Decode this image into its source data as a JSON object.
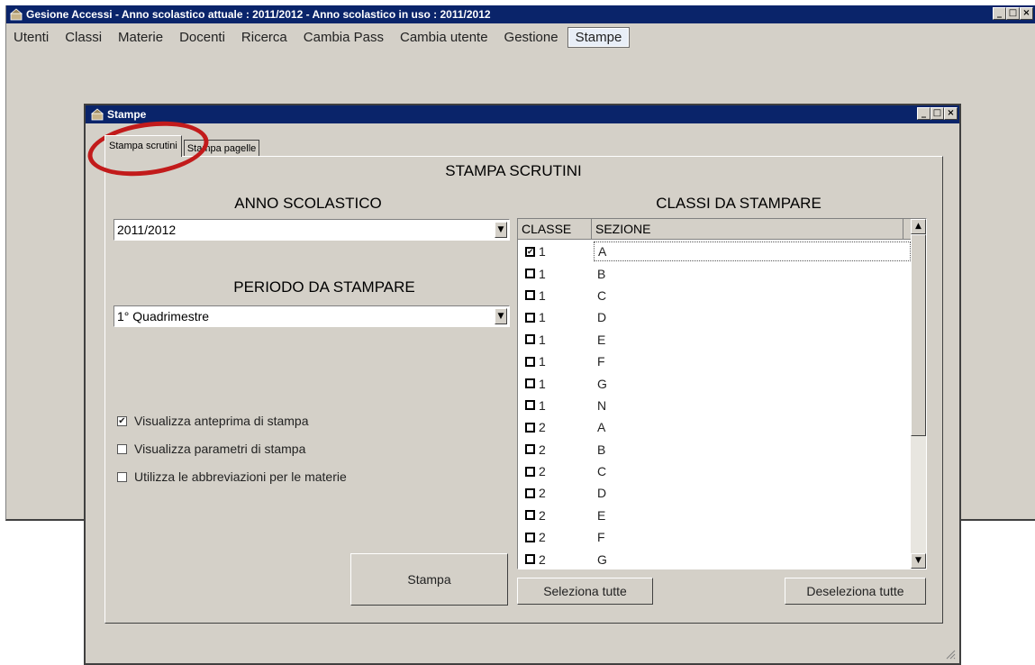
{
  "main_window": {
    "title": "Gesione Accessi - Anno scolastico attuale : 2011/2012 - Anno scolastico in uso : 2011/2012",
    "controls": {
      "minimize": "_",
      "maximize": "□",
      "close": "×"
    }
  },
  "menubar": {
    "items": [
      {
        "label": "Utenti"
      },
      {
        "label": "Classi"
      },
      {
        "label": "Materie"
      },
      {
        "label": "Docenti"
      },
      {
        "label": "Ricerca"
      },
      {
        "label": "Cambia Pass"
      },
      {
        "label": "Cambia utente"
      },
      {
        "label": "Gestione"
      },
      {
        "label": "Stampe",
        "active": true
      }
    ]
  },
  "child_window": {
    "title": "Stampe",
    "controls": {
      "minimize": "_",
      "maximize": "□",
      "close": "×"
    }
  },
  "tabs": [
    {
      "label": "Stampa scrutini",
      "active": true
    },
    {
      "label": "Stampa pagelle"
    }
  ],
  "panel": {
    "title": "STAMPA SCRUTINI",
    "anno_heading": "ANNO SCOLASTICO",
    "anno_value": "2011/2012",
    "periodo_heading": "PERIODO DA STAMPARE",
    "periodo_value": "1° Quadrimestre",
    "classi_heading": "CLASSI DA STAMPARE",
    "options": [
      {
        "label": "Visualizza anteprima di stampa",
        "checked": true
      },
      {
        "label": "Visualizza parametri di stampa",
        "checked": false
      },
      {
        "label": "Utilizza le abbreviazioni per le materie",
        "checked": false
      }
    ],
    "print_button": "Stampa",
    "select_all": "Seleziona tutte",
    "deselect_all": "Deseleziona tutte"
  },
  "grid": {
    "columns": [
      "CLASSE",
      "SEZIONE"
    ],
    "rows": [
      {
        "classe": "1",
        "sezione": "A",
        "checked": true
      },
      {
        "classe": "1",
        "sezione": "B",
        "checked": false
      },
      {
        "classe": "1",
        "sezione": "C",
        "checked": false
      },
      {
        "classe": "1",
        "sezione": "D",
        "checked": false
      },
      {
        "classe": "1",
        "sezione": "E",
        "checked": false
      },
      {
        "classe": "1",
        "sezione": "F",
        "checked": false
      },
      {
        "classe": "1",
        "sezione": "G",
        "checked": false
      },
      {
        "classe": "1",
        "sezione": "N",
        "checked": false
      },
      {
        "classe": "2",
        "sezione": "A",
        "checked": false
      },
      {
        "classe": "2",
        "sezione": "B",
        "checked": false
      },
      {
        "classe": "2",
        "sezione": "C",
        "checked": false
      },
      {
        "classe": "2",
        "sezione": "D",
        "checked": false
      },
      {
        "classe": "2",
        "sezione": "E",
        "checked": false
      },
      {
        "classe": "2",
        "sezione": "F",
        "checked": false
      },
      {
        "classe": "2",
        "sezione": "G",
        "checked": false
      }
    ]
  },
  "glyphs": {
    "check": "✔",
    "empty": "",
    "arrow_down": "▼",
    "arrow_up": "▲"
  },
  "colors": {
    "titlebar": "#0a246a",
    "face": "#d4d0c8",
    "highlight_ring": "#c21b1b"
  }
}
